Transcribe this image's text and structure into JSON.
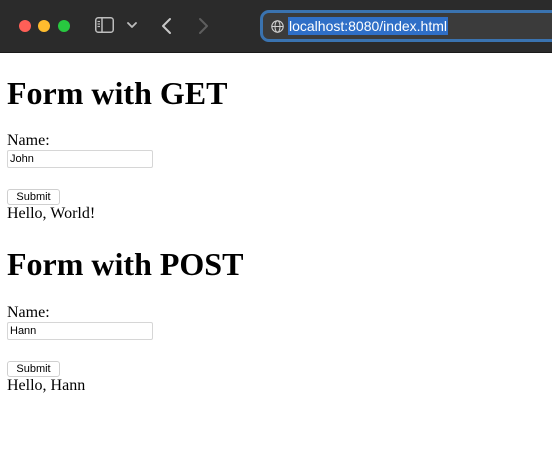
{
  "browser": {
    "url": "localhost:8080/index.html"
  },
  "get_form": {
    "heading": "Form with GET",
    "name_label": "Name:",
    "name_value": "John",
    "submit_label": "Submit",
    "result": "Hello, World!"
  },
  "post_form": {
    "heading": "Form with POST",
    "name_label": "Name:",
    "name_value": "Hann",
    "submit_label": "Submit",
    "result": "Hello, Hann"
  }
}
